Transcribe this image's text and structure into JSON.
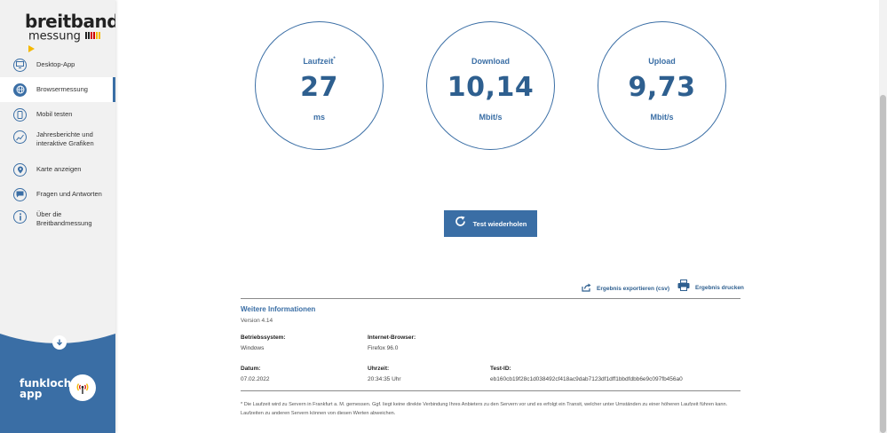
{
  "sidebar": {
    "logo": {
      "line1": "breitband",
      "line2": "messung"
    },
    "items": [
      {
        "label": "Desktop-App",
        "icon": "monitor-icon"
      },
      {
        "label": "Browsermessung",
        "icon": "globe-icon"
      },
      {
        "label": "Mobil testen",
        "icon": "mobile-icon"
      },
      {
        "label": "Jahresberichte und interaktive Grafiken",
        "icon": "chart-icon"
      },
      {
        "label": "Karte anzeigen",
        "icon": "map-pin-icon"
      },
      {
        "label": "Fragen und Antworten",
        "icon": "chat-icon"
      },
      {
        "label": "Über die Breitbandmessung",
        "icon": "info-icon"
      }
    ],
    "funkloch": {
      "line1": "funkloch-",
      "line2": "app"
    }
  },
  "results": {
    "latency": {
      "title": "Laufzeit",
      "marker": "*",
      "value": "27",
      "unit": "ms"
    },
    "download": {
      "title": "Download",
      "value": "10,14",
      "unit": "Mbit/s"
    },
    "upload": {
      "title": "Upload",
      "value": "9,73",
      "unit": "Mbit/s"
    }
  },
  "actions": {
    "retry": "Test wiederholen",
    "export": "Ergebnis exportieren (csv)",
    "print": "Ergebnis drucken"
  },
  "info": {
    "title": "Weitere Informationen",
    "version": "Version 4.14",
    "os_label": "Betriebssystem:",
    "os_value": "Windows",
    "browser_label": "Internet-Browser:",
    "browser_value": "Firefox 96.0",
    "date_label": "Datum:",
    "date_value": "07.02.2022",
    "time_label": "Uhrzeit:",
    "time_value": "20:34:35 Uhr",
    "testid_label": "Test-ID:",
    "testid_value": "eb160cb19f28c1d038492cf418ac9dab7123df1dff1bbdfdbb6e9c097fb456a0",
    "footnote": "* Die Laufzeit wird zu Servern in Frankfurt a. M. gemessen. Ggf. liegt keine direkte Verbindung Ihres Anbieters zu den Servern vor und es erfolgt ein Transit, welcher unter Umständen zu einer höheren Laufzeit führen kann. Laufzeiten zu anderen Servern können von diesen Werten abweichen."
  },
  "colors": {
    "accent": "#3a6ea5",
    "accent_dark": "#2e5f8f",
    "sidebar_bg": "#f1f1f1"
  }
}
